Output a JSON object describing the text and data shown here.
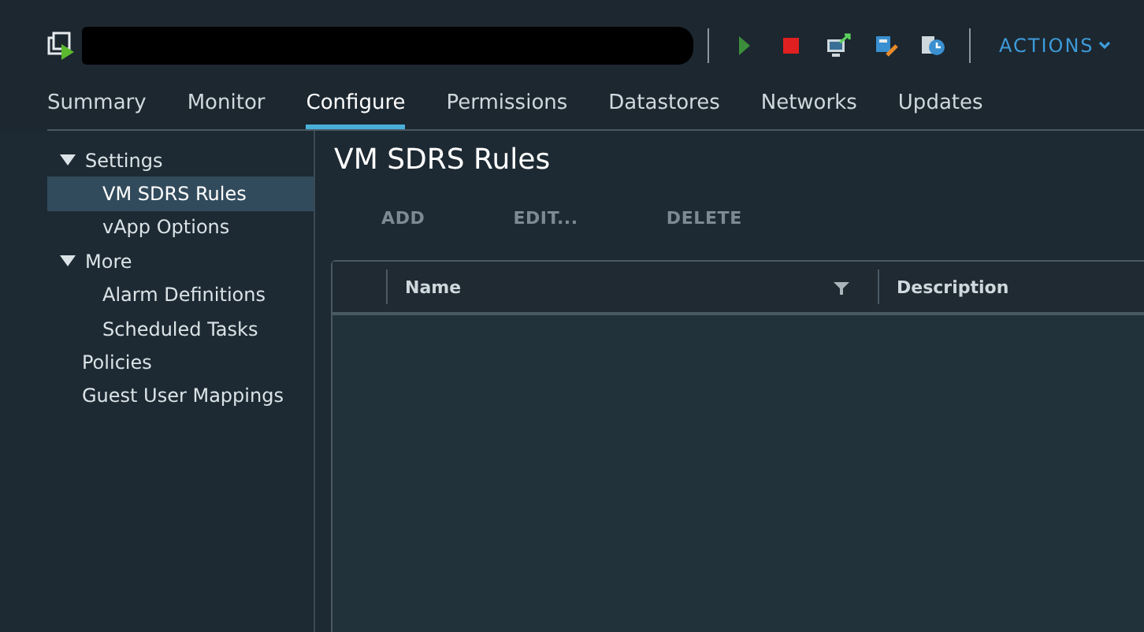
{
  "header": {
    "actions_label": "ACTIONS"
  },
  "tabs": [
    {
      "label": "Summary",
      "selected": false
    },
    {
      "label": "Monitor",
      "selected": false
    },
    {
      "label": "Configure",
      "selected": true
    },
    {
      "label": "Permissions",
      "selected": false
    },
    {
      "label": "Datastores",
      "selected": false
    },
    {
      "label": "Networks",
      "selected": false
    },
    {
      "label": "Updates",
      "selected": false
    }
  ],
  "sidebar": {
    "items": [
      {
        "label": "Settings",
        "expanded": true,
        "selected": false,
        "children": [
          {
            "label": "VM SDRS Rules",
            "selected": true
          },
          {
            "label": "vApp Options",
            "selected": false
          }
        ]
      },
      {
        "label": "More",
        "expanded": true,
        "selected": false,
        "children": [
          {
            "label": "Alarm Definitions",
            "selected": false
          },
          {
            "label": "Scheduled Tasks",
            "selected": false
          }
        ]
      },
      {
        "label": "Policies",
        "selected": false
      },
      {
        "label": "Guest User Mappings",
        "selected": false
      }
    ]
  },
  "page_title": "VM SDRS Rules",
  "toolbar": [
    {
      "label": "ADD",
      "disabled": true
    },
    {
      "label": "EDIT...",
      "disabled": true
    },
    {
      "label": "DELETE",
      "disabled": true
    }
  ],
  "table": {
    "columns": [
      {
        "label": "Name",
        "filter": true
      },
      {
        "label": "Description",
        "filter": false
      }
    ]
  }
}
